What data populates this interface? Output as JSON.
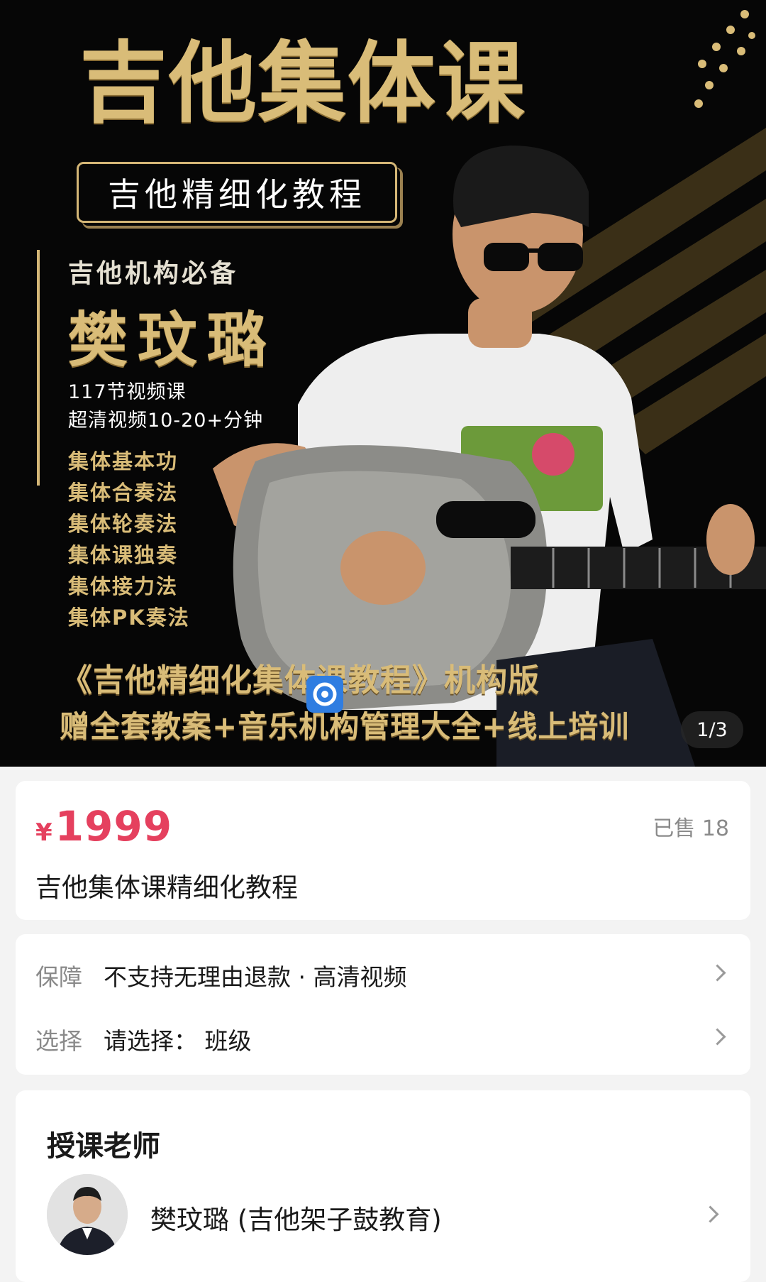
{
  "banner": {
    "title": "吉他集体课",
    "subtitle": "吉他精细化教程",
    "tagline": "吉他机构必备",
    "teacher": "樊玟璐",
    "stats": [
      "117节视频课",
      "超清视频10-20+分钟"
    ],
    "methods": [
      "集体基本功",
      "集体合奏法",
      "集体轮奏法",
      "集体课独奏",
      "集体接力法",
      "集体PK奏法"
    ],
    "promo_line1": "《吉他精细化集体课教程》机构版",
    "promo_line2": "赠全套教案+音乐机构管理大全+线上培训",
    "page_counter": "1/3",
    "gold": "#d9bc78"
  },
  "product": {
    "currency": "¥",
    "price": "1999",
    "sold": "已售 18",
    "title": "吉他集体课精细化教程",
    "price_color": "#e5405e"
  },
  "options": {
    "guarantee_label": "保障",
    "guarantee_value": "不支持无理由退款 · 高清视频",
    "select_label": "选择",
    "select_value": "请选择：  班级"
  },
  "teacher_section": {
    "heading": "授课老师",
    "name": "樊玟璐 (吉他架子鼓教育)"
  },
  "icons": [
    "chevron-right-icon",
    "app-logo-icon",
    "teacher-avatar"
  ]
}
